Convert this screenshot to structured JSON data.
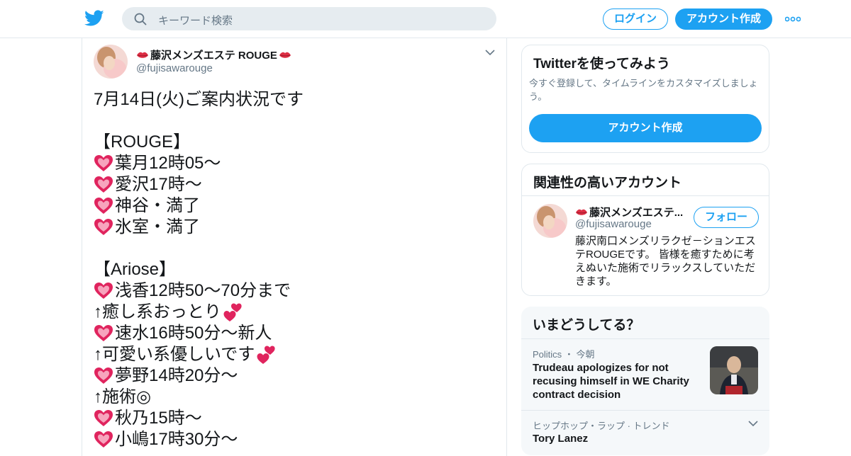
{
  "header": {
    "logo_icon": "twitter-bird-icon",
    "search_placeholder": "キーワード検索",
    "login_label": "ログイン",
    "signup_label": "アカウント作成",
    "more_icon": "more-dots-icon"
  },
  "tweet": {
    "display_name": "藤沢メンズエステ ROUGE",
    "handle": "@fujisawarouge",
    "lines": [
      {
        "prefix": "",
        "text": "7月14日(火)ご案内状況です",
        "suffix": ""
      },
      {
        "prefix": "",
        "text": "",
        "suffix": ""
      },
      {
        "prefix": "",
        "text": "【ROUGE】",
        "suffix": ""
      },
      {
        "prefix": "heart",
        "text": "葉月12時05～",
        "suffix": ""
      },
      {
        "prefix": "heart",
        "text": "愛沢17時～",
        "suffix": ""
      },
      {
        "prefix": "heart",
        "text": "神谷・満了",
        "suffix": ""
      },
      {
        "prefix": "heart",
        "text": "氷室・満了",
        "suffix": ""
      },
      {
        "prefix": "",
        "text": "",
        "suffix": ""
      },
      {
        "prefix": "",
        "text": "【Ariose】",
        "suffix": ""
      },
      {
        "prefix": "heart",
        "text": "浅香12時50〜70分まで",
        "suffix": ""
      },
      {
        "prefix": "",
        "text": "↑癒し系おっとり",
        "suffix": "twohearts"
      },
      {
        "prefix": "heart",
        "text": "速水16時50分～新人",
        "suffix": ""
      },
      {
        "prefix": "",
        "text": "↑可愛い系優しいです",
        "suffix": "twohearts"
      },
      {
        "prefix": "heart",
        "text": "夢野14時20分～",
        "suffix": ""
      },
      {
        "prefix": "",
        "text": "↑施術◎",
        "suffix": ""
      },
      {
        "prefix": "heart",
        "text": "秋乃15時～",
        "suffix": ""
      },
      {
        "prefix": "heart",
        "text": "小嶋17時30分～",
        "suffix": ""
      }
    ]
  },
  "signup_card": {
    "title": "Twitterを使ってみよう",
    "description": "今すぐ登録して、タイムラインをカスタマイズしましょう。",
    "button_label": "アカウント作成"
  },
  "related": {
    "title": "関連性の高いアカウント",
    "name": "藤沢メンズエステ...",
    "handle": "@fujisawarouge",
    "follow_label": "フォロー",
    "bio": "藤沢南口メンズリラクゼ－ションエステROUGEです。 皆様を癒すために考えぬいた施術でリラックスしていただきます。"
  },
  "trends": {
    "title": "いまどうしてる？",
    "items": [
      {
        "category": "Politics",
        "dot": "・",
        "time": "今朝",
        "headline": "Trudeau apologizes for not recusing himself in WE Charity contract decision"
      },
      {
        "meta": "ヒップホップ・ラップ · トレンド",
        "name": "Tory Lanez"
      }
    ]
  },
  "colors": {
    "accent": "#1da1f2",
    "heart": "#e0245e",
    "muted": "#657786"
  }
}
